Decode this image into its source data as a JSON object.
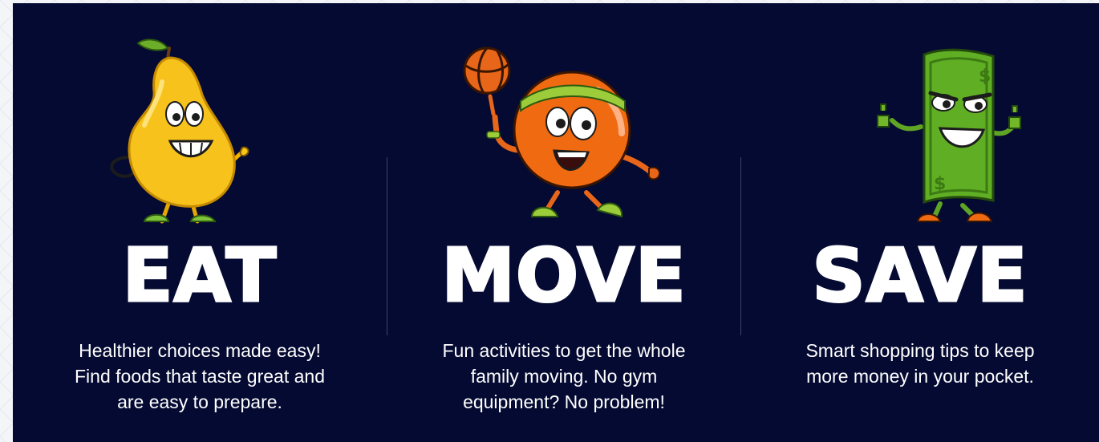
{
  "colors": {
    "background": "#050a32",
    "text": "#ffffff",
    "divider": "#3b4266"
  },
  "features": [
    {
      "icon": "pear-mascot-icon",
      "heading": "EAT",
      "desc_line1": "Healthier choices made easy!",
      "desc_line2": "Find foods that taste great and",
      "desc_line3": "are easy to prepare."
    },
    {
      "icon": "orange-basketball-mascot-icon",
      "heading": "MOVE",
      "desc_line1": "Fun activities to get the whole",
      "desc_line2": "family moving. No gym",
      "desc_line3": "equipment? No problem!"
    },
    {
      "icon": "dollar-bill-mascot-icon",
      "heading": "SAVE",
      "desc_line1": "Smart shopping tips to keep",
      "desc_line2": "more money in your pocket."
    }
  ]
}
